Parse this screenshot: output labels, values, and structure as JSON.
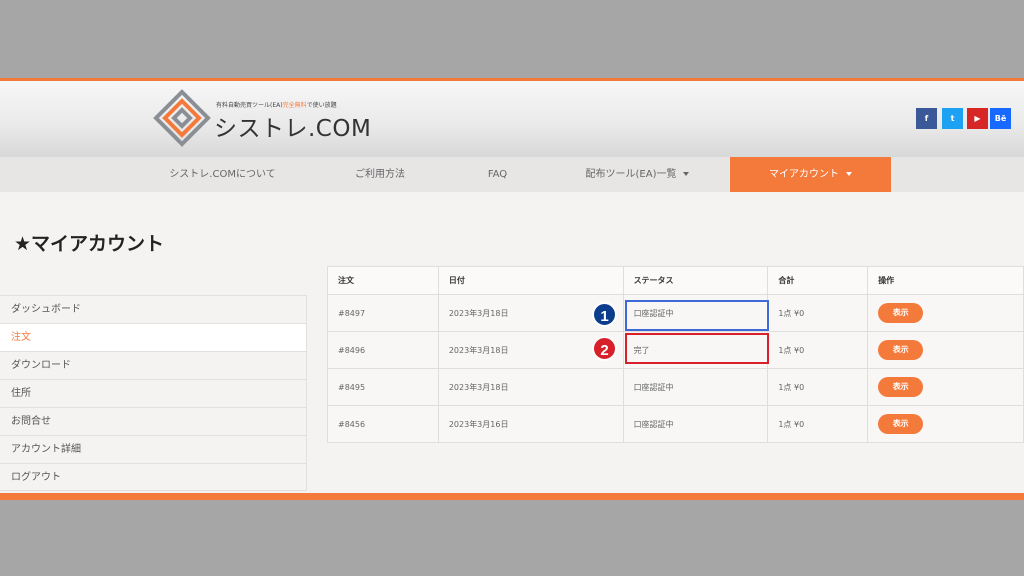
{
  "header": {
    "tagline_pre": "有料自動売買ツール(EA)",
    "tagline_hl": "完全無料",
    "tagline_post": "で使い放題",
    "site_name": "シストレ.COM",
    "social": [
      "f",
      "t",
      "▶",
      "Bē"
    ]
  },
  "nav": {
    "items": [
      "シストレ.COMについて",
      "ご利用方法",
      "FAQ",
      "配布ツール(EA)一覧",
      "マイアカウント"
    ]
  },
  "page": {
    "title": "★マイアカウント"
  },
  "sidebar": {
    "items": [
      "ダッシュボード",
      "注文",
      "ダウンロード",
      "住所",
      "お問合せ",
      "アカウント詳細",
      "ログアウト"
    ]
  },
  "orders": {
    "headers": [
      "注文",
      "日付",
      "ステータス",
      "合計",
      "操作"
    ],
    "rows": [
      {
        "id": "#8497",
        "date": "2023年3月18日",
        "status": "口座認証中",
        "total": "1点 ¥0",
        "action": "表示"
      },
      {
        "id": "#8496",
        "date": "2023年3月18日",
        "status": "完了",
        "total": "1点 ¥0",
        "action": "表示"
      },
      {
        "id": "#8495",
        "date": "2023年3月18日",
        "status": "口座認証中",
        "total": "1点 ¥0",
        "action": "表示"
      },
      {
        "id": "#8456",
        "date": "2023年3月16日",
        "status": "口座認証中",
        "total": "1点 ¥0",
        "action": "表示"
      }
    ]
  },
  "annotations": [
    "1",
    "2"
  ],
  "colors": {
    "accent": "#f47a3c",
    "highlight_blue": "#3d6ad6",
    "highlight_red": "#d8202a",
    "badge_blue": "#0c3d8c"
  }
}
